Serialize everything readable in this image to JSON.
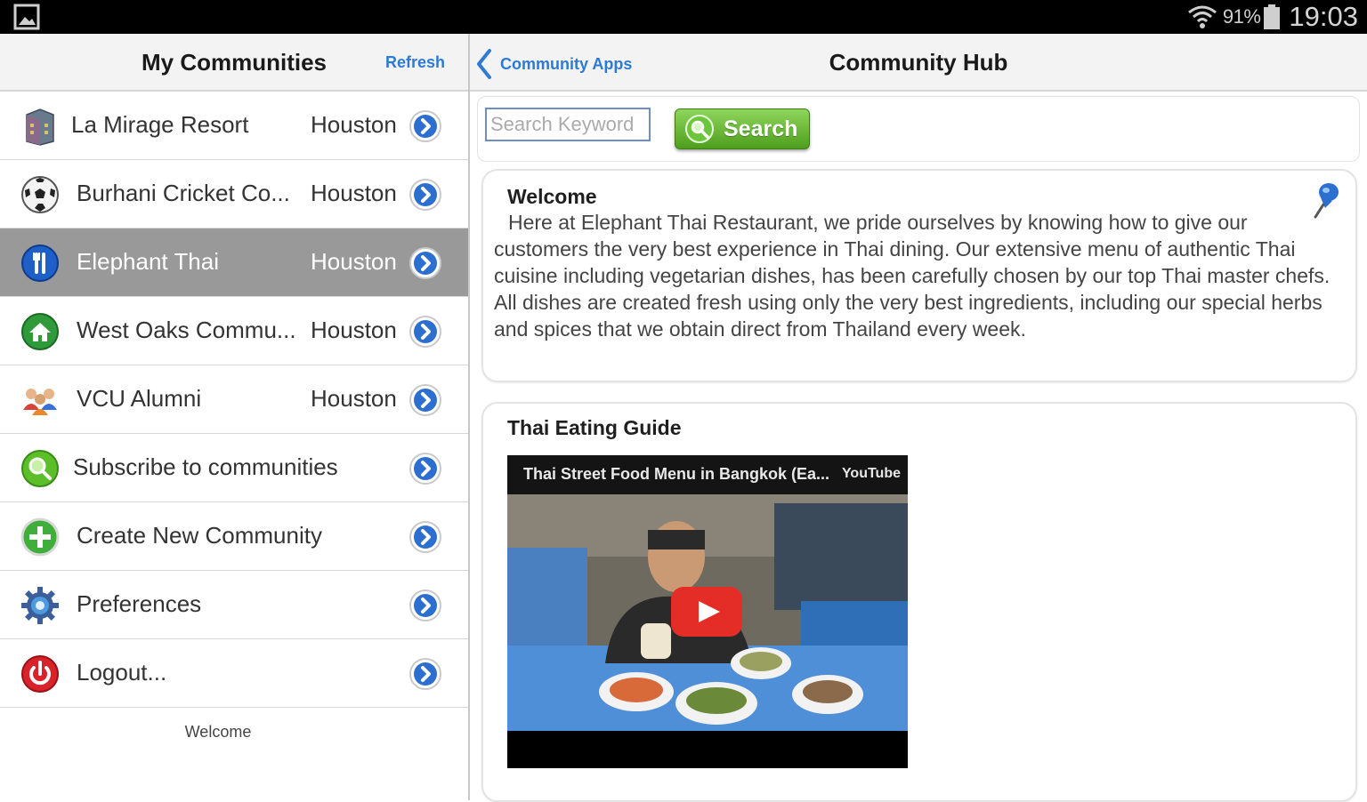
{
  "status_bar": {
    "battery_percent": "91%",
    "time": "19:03",
    "icons": [
      "gallery-icon",
      "wifi-icon",
      "battery-icon"
    ]
  },
  "left_pane": {
    "title": "My Communities",
    "refresh_label": "Refresh",
    "items": [
      {
        "label": "La Mirage Resort",
        "city": "Houston",
        "icon": "building-icon",
        "selected": false
      },
      {
        "label": "Burhani Cricket Co...",
        "city": "Houston",
        "icon": "soccer-ball-icon",
        "selected": false
      },
      {
        "label": "Elephant Thai",
        "city": "Houston",
        "icon": "utensils-icon",
        "selected": true
      },
      {
        "label": "West Oaks Commu...",
        "city": "Houston",
        "icon": "house-icon",
        "selected": false
      },
      {
        "label": "VCU Alumni",
        "city": "Houston",
        "icon": "people-icon",
        "selected": false
      },
      {
        "label": "Subscribe to communities",
        "city": "",
        "icon": "magnifier-icon",
        "selected": false
      },
      {
        "label": "Create New Community",
        "city": "",
        "icon": "plus-icon",
        "selected": false
      },
      {
        "label": "Preferences",
        "city": "",
        "icon": "gear-icon",
        "selected": false
      },
      {
        "label": "Logout...",
        "city": "",
        "icon": "power-icon",
        "selected": false
      }
    ],
    "footer_text": "Welcome"
  },
  "right_pane": {
    "back_label": "Community Apps",
    "title": "Community Hub",
    "search": {
      "placeholder": "Search Keyword",
      "value": "",
      "button_label": "Search"
    },
    "welcome_card": {
      "title": "Welcome",
      "body": "Here at Elephant Thai Restaurant, we pride ourselves by knowing how to give our customers the very best experience in Thai dining. Our extensive menu of authentic Thai cuisine including vegetarian dishes, has been carefully chosen by our top Thai master chefs. All dishes are created fresh using only the very best ingredients, including our special herbs and spices that we obtain direct from Thailand every week."
    },
    "video_card": {
      "title": "Thai Eating Guide",
      "video_title": "Thai Street Food Menu in Bangkok (Ea...",
      "video_brand": "YouTube"
    }
  },
  "colors": {
    "link_blue": "#2d7ad6",
    "selected_row": "#999999",
    "search_green": "#5aa827",
    "youtube_red": "#e52d27"
  }
}
